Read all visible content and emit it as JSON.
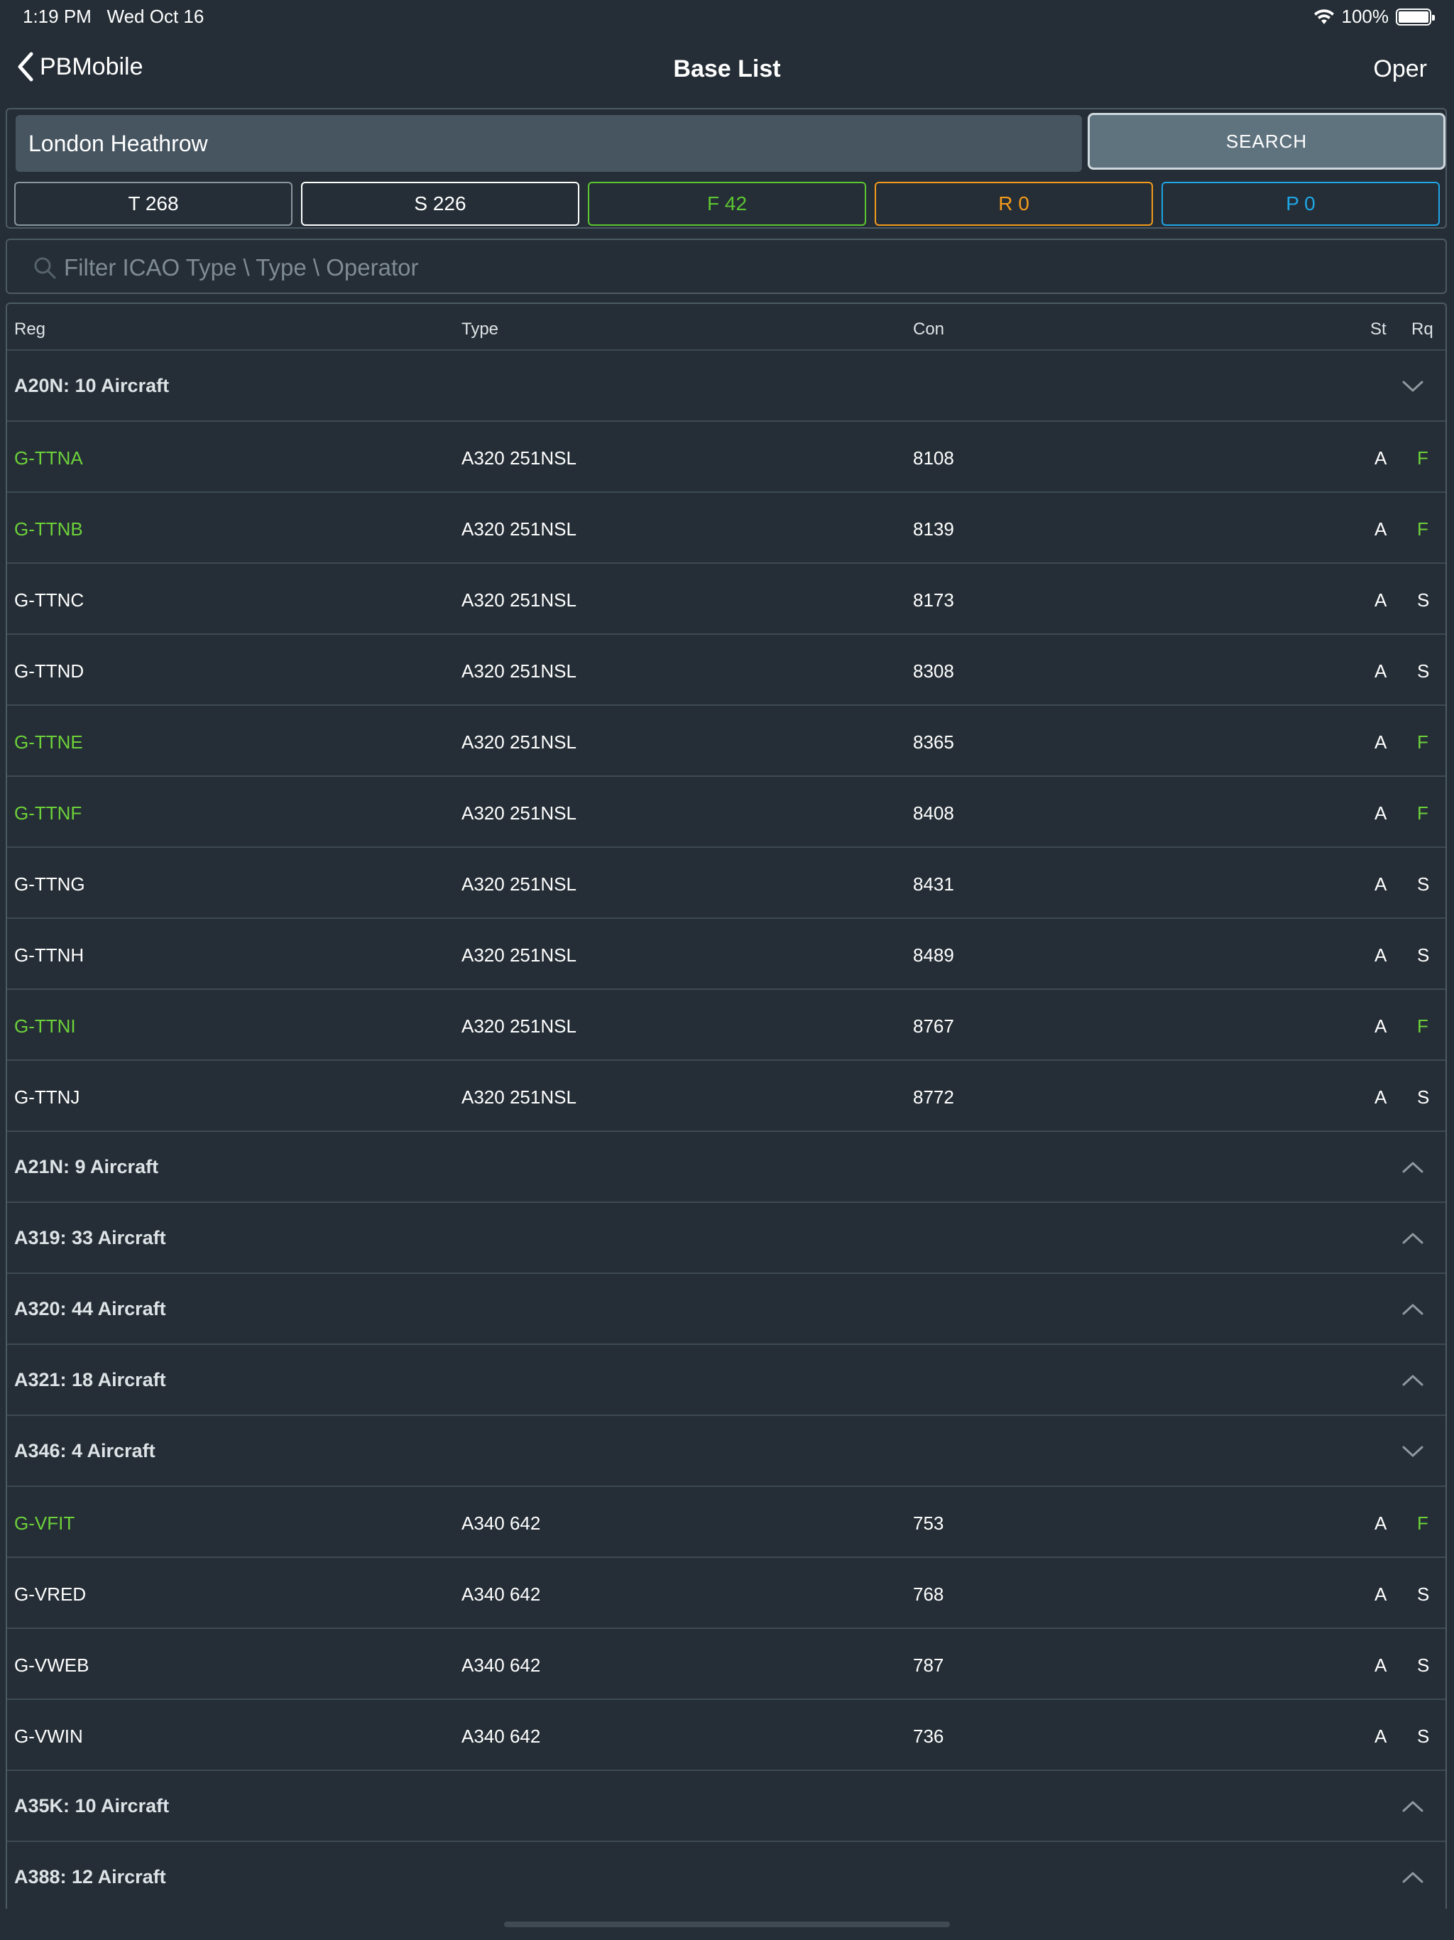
{
  "status": {
    "time": "1:19 PM",
    "date": "Wed Oct 16",
    "battery": "100%",
    "battery_level": 1.0
  },
  "nav": {
    "back_label": "PBMobile",
    "title": "Base List",
    "right_label": "Oper"
  },
  "search": {
    "value": "London Heathrow",
    "button_label": "SEARCH"
  },
  "counts": [
    {
      "label": "T 268",
      "color": "#8a969e",
      "text_color": "#ffffff"
    },
    {
      "label": "S 226",
      "color": "#ffffff",
      "text_color": "#ffffff"
    },
    {
      "label": "F 42",
      "color": "#5cc630",
      "text_color": "#5cc630"
    },
    {
      "label": "R 0",
      "color": "#f39a1c",
      "text_color": "#f39a1c"
    },
    {
      "label": "P 0",
      "color": "#1ea6e6",
      "text_color": "#1ea6e6"
    }
  ],
  "filter": {
    "placeholder": "Filter ICAO Type \\ Type \\ Operator"
  },
  "table": {
    "headers": {
      "reg": "Reg",
      "type": "Type",
      "con": "Con",
      "st": "St",
      "rq": "Rq"
    },
    "groups": [
      {
        "label": "A20N: 10 Aircraft",
        "expanded": true,
        "rows": [
          {
            "reg": "G-TTNA",
            "type": "A320 251NSL",
            "con": "8108",
            "st": "A",
            "rq": "F"
          },
          {
            "reg": "G-TTNB",
            "type": "A320 251NSL",
            "con": "8139",
            "st": "A",
            "rq": "F"
          },
          {
            "reg": "G-TTNC",
            "type": "A320 251NSL",
            "con": "8173",
            "st": "A",
            "rq": "S"
          },
          {
            "reg": "G-TTND",
            "type": "A320 251NSL",
            "con": "8308",
            "st": "A",
            "rq": "S"
          },
          {
            "reg": "G-TTNE",
            "type": "A320 251NSL",
            "con": "8365",
            "st": "A",
            "rq": "F"
          },
          {
            "reg": "G-TTNF",
            "type": "A320 251NSL",
            "con": "8408",
            "st": "A",
            "rq": "F"
          },
          {
            "reg": "G-TTNG",
            "type": "A320 251NSL",
            "con": "8431",
            "st": "A",
            "rq": "S"
          },
          {
            "reg": "G-TTNH",
            "type": "A320 251NSL",
            "con": "8489",
            "st": "A",
            "rq": "S"
          },
          {
            "reg": "G-TTNI",
            "type": "A320 251NSL",
            "con": "8767",
            "st": "A",
            "rq": "F"
          },
          {
            "reg": "G-TTNJ",
            "type": "A320 251NSL",
            "con": "8772",
            "st": "A",
            "rq": "S"
          }
        ]
      },
      {
        "label": "A21N: 9 Aircraft",
        "expanded": false,
        "rows": []
      },
      {
        "label": "A319: 33 Aircraft",
        "expanded": false,
        "rows": []
      },
      {
        "label": "A320: 44 Aircraft",
        "expanded": false,
        "rows": []
      },
      {
        "label": "A321: 18 Aircraft",
        "expanded": false,
        "rows": []
      },
      {
        "label": "A346: 4 Aircraft",
        "expanded": true,
        "rows": [
          {
            "reg": "G-VFIT",
            "type": "A340 642",
            "con": "753",
            "st": "A",
            "rq": "F"
          },
          {
            "reg": "G-VRED",
            "type": "A340 642",
            "con": "768",
            "st": "A",
            "rq": "S"
          },
          {
            "reg": "G-VWEB",
            "type": "A340 642",
            "con": "787",
            "st": "A",
            "rq": "S"
          },
          {
            "reg": "G-VWIN",
            "type": "A340 642",
            "con": "736",
            "st": "A",
            "rq": "S"
          }
        ]
      },
      {
        "label": "A35K: 10 Aircraft",
        "expanded": false,
        "rows": []
      },
      {
        "label": "A388: 12 Aircraft",
        "expanded": false,
        "rows": []
      }
    ]
  },
  "colors": {
    "background": "#252e36",
    "flagged": "#6dd13a",
    "divider": "#3d4a53"
  }
}
